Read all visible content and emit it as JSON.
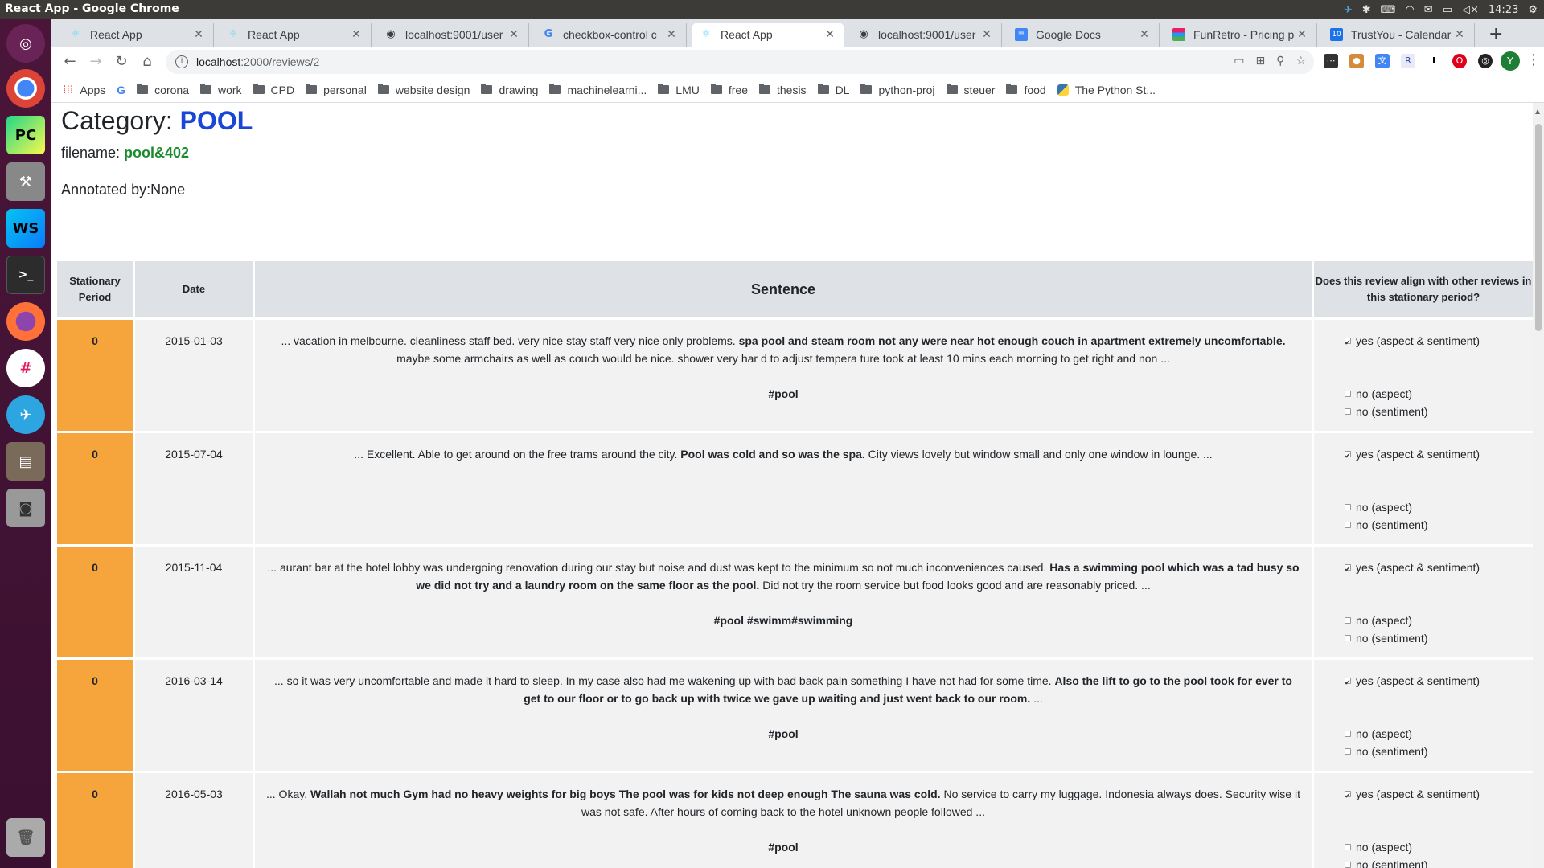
{
  "system": {
    "window_title": "React App - Google Chrome",
    "clock": "14:23"
  },
  "tabs": [
    {
      "label": "React App",
      "favicon": "react-icon"
    },
    {
      "label": "React App",
      "favicon": "react-icon"
    },
    {
      "label": "localhost:9001/user",
      "favicon": "globe-icon"
    },
    {
      "label": "checkbox-control c",
      "favicon": "google-icon"
    },
    {
      "label": "React App",
      "favicon": "react-icon",
      "active": true
    },
    {
      "label": "localhost:9001/user",
      "favicon": "globe-icon"
    },
    {
      "label": "Google Docs",
      "favicon": "docs-icon"
    },
    {
      "label": "FunRetro - Pricing p",
      "favicon": "funretro-icon"
    },
    {
      "label": "TrustYou - Calendar",
      "favicon": "calendar-icon"
    }
  ],
  "address_bar": {
    "host": "localhost",
    "path": ":2000/reviews/2"
  },
  "bookmarks": {
    "apps": "Apps",
    "folders": [
      "corona",
      "work",
      "CPD",
      "personal",
      "website design",
      "drawing",
      "machinelearni...",
      "LMU",
      "free",
      "thesis",
      "DL",
      "python-proj",
      "steuer",
      "food"
    ],
    "python": "The Python St..."
  },
  "profile_initial": "Y",
  "header": {
    "category_label": "Category: ",
    "category_value": "POOL",
    "filename_label": "filename: ",
    "filename_value": "pool&402",
    "annotated": "Annotated by:None"
  },
  "table": {
    "headers": {
      "period": "Stationary Period",
      "date": "Date",
      "sentence": "Sentence",
      "align": "Does this review align with other reviews in this stationary period?"
    },
    "options": {
      "yes": "yes (aspect & sentiment)",
      "no_aspect": "no (aspect)",
      "no_sentiment": "no (sentiment)"
    },
    "rows": [
      {
        "period": "0",
        "date": "2015-01-03",
        "pre": "... vacation in melbourne. cleanliness staff bed. very nice stay staff very nice only problems. ",
        "bold": "spa pool and steam room not any were near hot enough couch in apartment extremely uncomfortable.",
        "post": " maybe some armchairs as well as couch would be nice. shower very har d to adjust tempera ture took at least 10 mins each morning to get right and non ...",
        "tags": "#pool"
      },
      {
        "period": "0",
        "date": "2015-07-04",
        "pre": "... Excellent. Able to get around on the free trams around the city. ",
        "bold": "Pool was cold and so was the spa.",
        "post": " City views lovely but window small and only one window in lounge. ...",
        "tags": ""
      },
      {
        "period": "0",
        "date": "2015-11-04",
        "pre": "... aurant bar at the hotel lobby was undergoing renovation during our stay but noise and dust was kept to the minimum so not much inconveniences caused. ",
        "bold": "Has a swimming pool which was a tad busy so we did not try and a laundry room on the same floor as the pool.",
        "post": " Did not try the room service but food looks good and are reasonably priced. ...",
        "tags": "#pool #swimm#swimming"
      },
      {
        "period": "0",
        "date": "2016-03-14",
        "pre": "... so it was very uncomfortable and made it hard to sleep. In my case also had me wakening up with bad back pain something I have not had for some time. ",
        "bold": "Also the lift to go to the pool took for ever to get to our floor or to go back up with twice we gave up waiting and just went back to our room.",
        "post": " ...",
        "tags": "#pool"
      },
      {
        "period": "0",
        "date": "2016-05-03",
        "pre": "... Okay. ",
        "bold": "Wallah not much Gym had no heavy weights for big boys The pool was for kids not deep enough The sauna was cold.",
        "post": " No service to carry my luggage. Indonesia always does. Security wise it was not safe. After hours of coming back to the hotel unknown people followed ...",
        "tags": "#pool"
      }
    ]
  },
  "colors": {
    "category": "#1a46d6",
    "filename": "#1b8a2c",
    "period_cell": "#f6a53c",
    "header_bg": "#dee2e6",
    "cell_bg": "#f2f2f2"
  }
}
